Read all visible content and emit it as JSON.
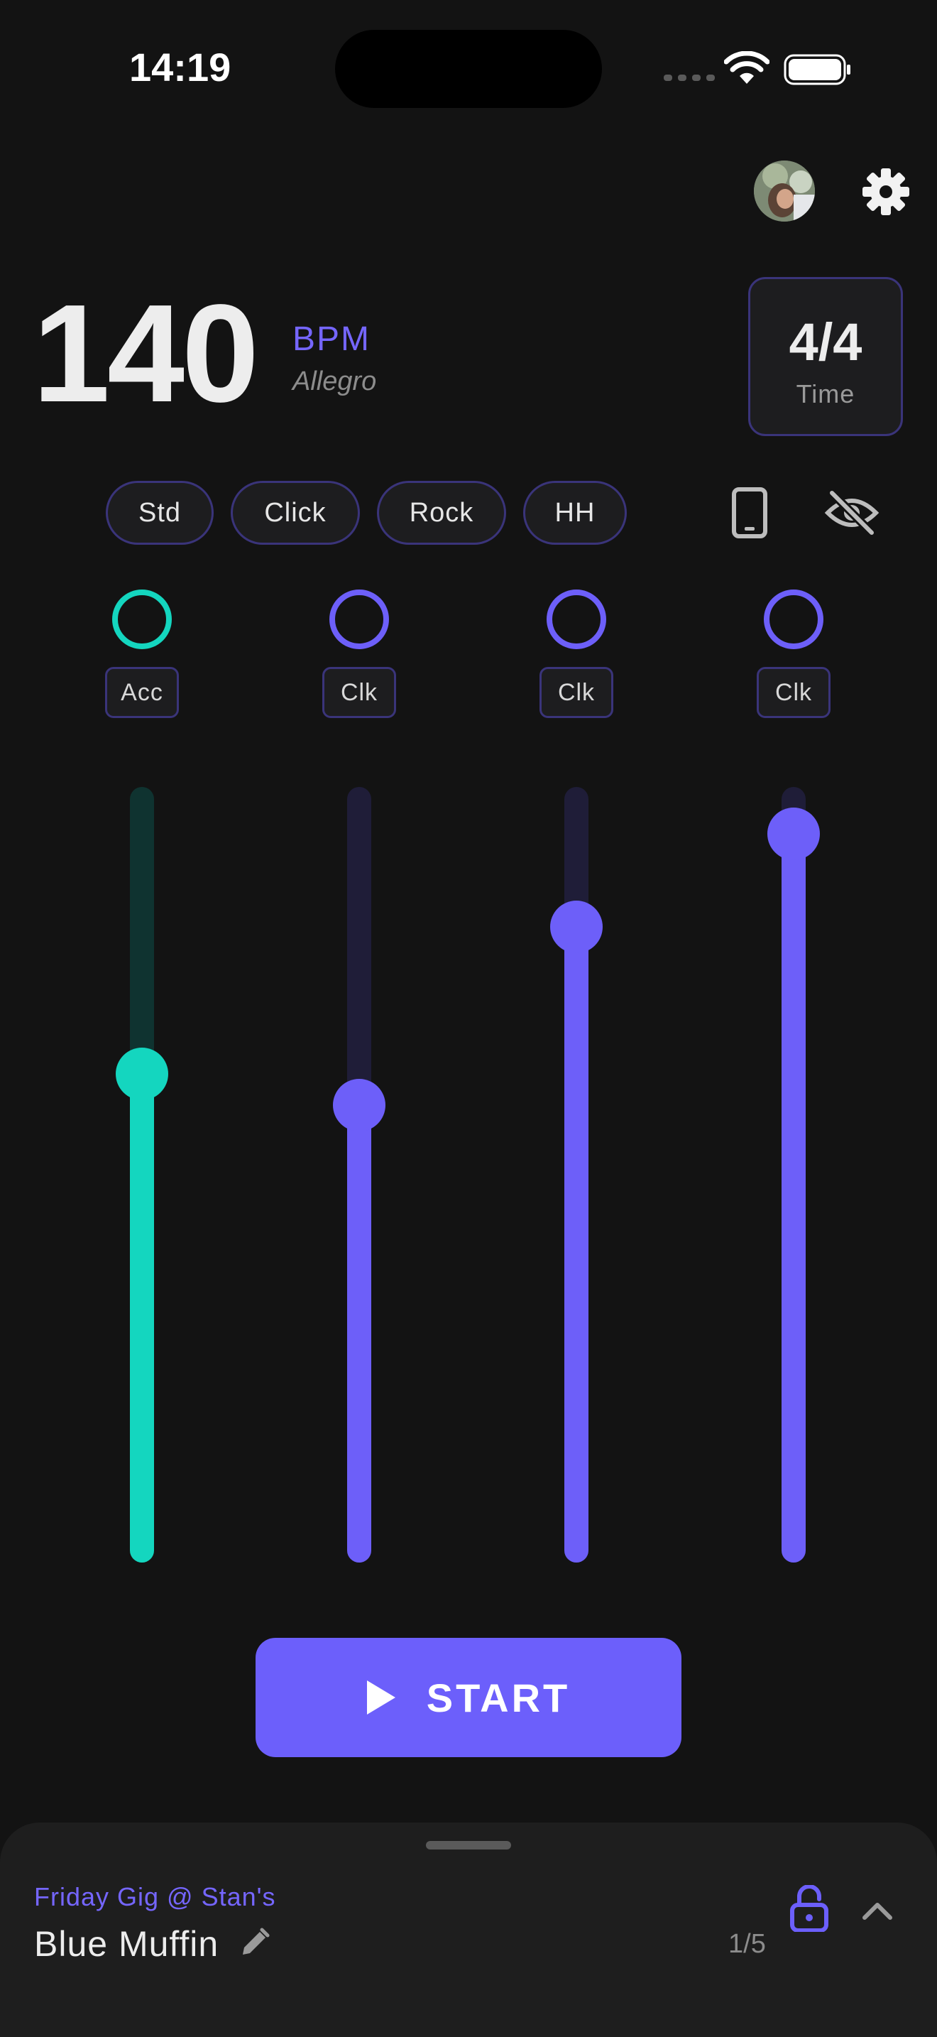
{
  "status_bar": {
    "time": "14:19"
  },
  "tempo": {
    "bpm": "140",
    "unit": "BPM",
    "name": "Allegro"
  },
  "time_signature": {
    "value": "4/4",
    "label": "Time"
  },
  "presets": [
    {
      "label": "Std"
    },
    {
      "label": "Click"
    },
    {
      "label": "Rock"
    },
    {
      "label": "HH"
    }
  ],
  "icons": {
    "settings": "gear-icon",
    "device": "phone-icon",
    "visibility": "eye-off-icon",
    "play": "play-icon",
    "edit": "pencil-icon",
    "lock": "lock-open-icon",
    "expand": "chevron-up-icon"
  },
  "beats": [
    {
      "label": "Acc",
      "level": 0.63,
      "accent": true
    },
    {
      "label": "Clk",
      "level": 0.59,
      "accent": false
    },
    {
      "label": "Clk",
      "level": 0.82,
      "accent": false
    },
    {
      "label": "Clk",
      "level": 0.94,
      "accent": false
    }
  ],
  "colors": {
    "accent": "#14d6bf",
    "primary": "#6c5ffb",
    "background": "#131313"
  },
  "start_button": {
    "label": "START"
  },
  "setlist": {
    "name": "Friday Gig @ Stan's",
    "song": "Blue Muffin",
    "position": "1/5"
  }
}
